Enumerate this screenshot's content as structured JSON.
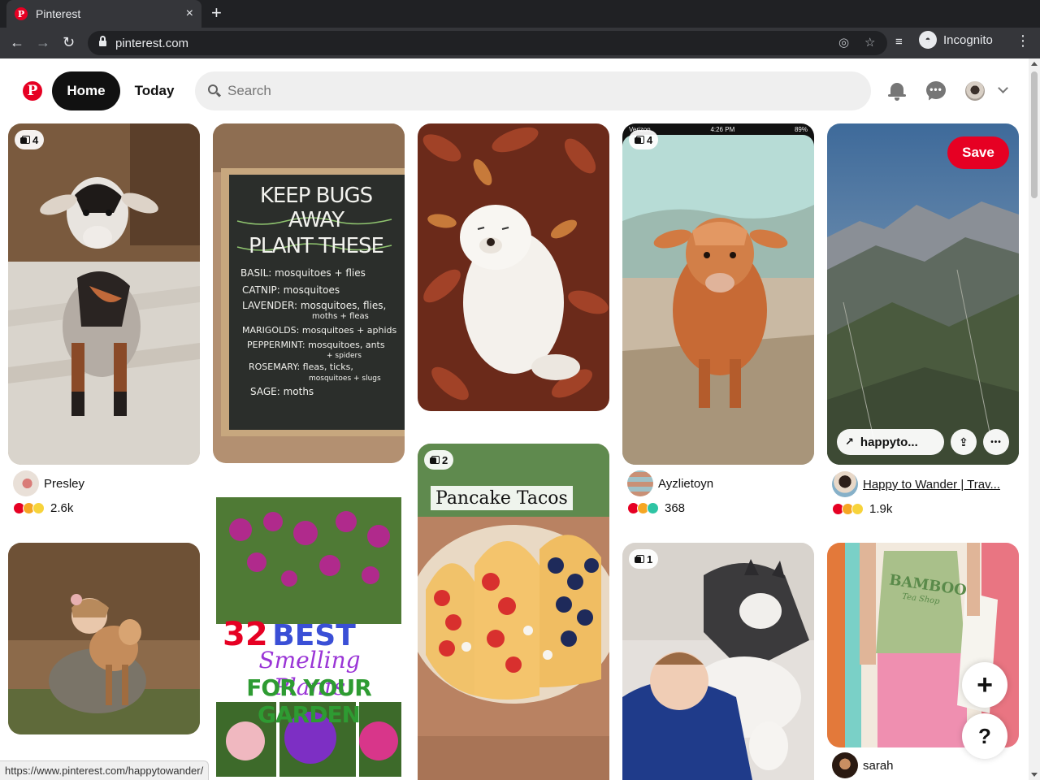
{
  "browser": {
    "tab_title": "Pinterest",
    "tab_close": "×",
    "new_tab": "+",
    "url": "pinterest.com",
    "incognito_label": "Incognito",
    "back": "←",
    "forward": "→",
    "reload": "↻",
    "menu": "⋮",
    "status_url": "https://www.pinterest.com/happytowander/"
  },
  "header": {
    "logo": "P",
    "nav_home": "Home",
    "nav_today": "Today",
    "search_placeholder": "Search",
    "chat_dots": "•••"
  },
  "pins": [
    {
      "id": "goat",
      "badge": "4",
      "creator": "Presley",
      "reaction_count": "2.6k",
      "reactions": [
        "heart",
        "wow",
        "haha"
      ]
    },
    {
      "id": "chalkboard",
      "lines": [
        "KEEP BUGS AWAY",
        "PLANT THESE",
        "BASIL: mosquitoes + flies",
        "CATNIP: mosquitoes",
        "LAVENDER: mosquitoes, flies,",
        "moths + fleas",
        "MARIGOLDS: mosquitoes + aphids",
        "PEPPERMINT: mosquitoes, ants",
        "+ spiders",
        "ROSEMARY: fleas, ticks,",
        "mosquitoes + slugs",
        "SAGE: moths"
      ]
    },
    {
      "id": "puppy"
    },
    {
      "id": "calf",
      "badge": "4",
      "creator": "Ayzlietoyn",
      "reaction_count": "368",
      "reactions": [
        "heart",
        "wow",
        "star"
      ],
      "phone_status": {
        "carrier": "Verizon",
        "time": "4:26 PM",
        "battery": "89%"
      }
    },
    {
      "id": "mountain",
      "save_label": "Save",
      "link_label": "happyto...",
      "creator": "Happy to Wander | Trav...",
      "reaction_count": "1.9k",
      "reactions": [
        "heart",
        "wow",
        "haha"
      ],
      "upload_icon": "⇪",
      "more_icon": "•••"
    },
    {
      "id": "girl-goat"
    },
    {
      "id": "flowers",
      "headline_num": "32",
      "headline_best": "BEST",
      "headline_script": "Smelling Plants",
      "headline_sub": "FOR YOUR GARDEN"
    },
    {
      "id": "tacos",
      "badge": "2",
      "title_text": "Pancake Tacos"
    },
    {
      "id": "husky",
      "badge": "1"
    },
    {
      "id": "fashion",
      "creator": "sarah",
      "shirt_text": "BAMBOO",
      "shirt_sub": "Tea Shop"
    }
  ],
  "fab": {
    "add": "+",
    "help": "?"
  }
}
